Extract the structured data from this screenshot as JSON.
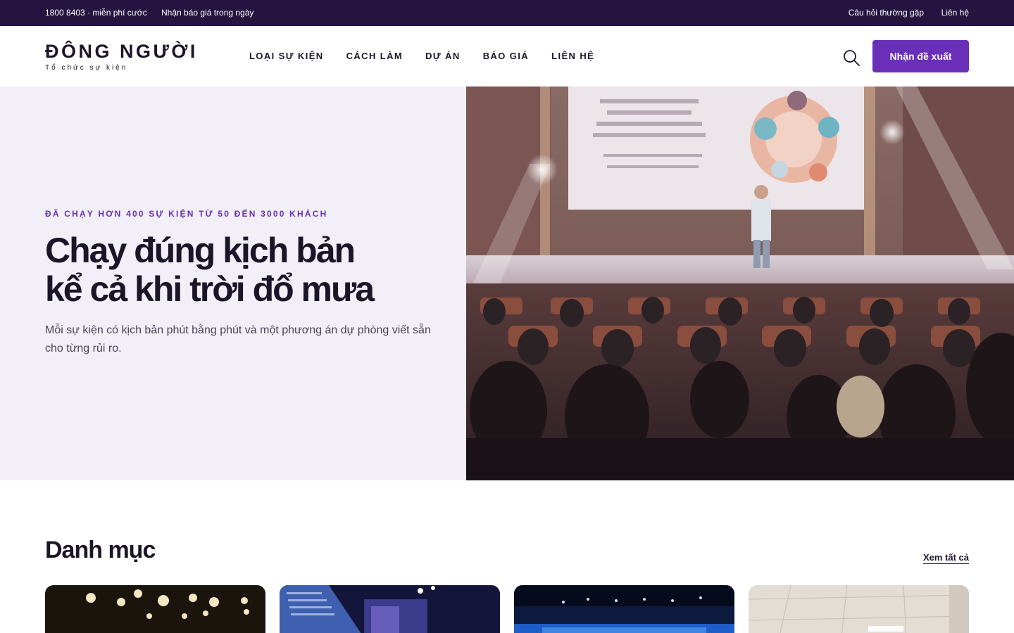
{
  "topbar": {
    "phone": "1800 8403 · miễn phí cước",
    "quote_note": "Nhận báo giá trong ngày",
    "faq": "Câu hỏi thường gặp",
    "contact": "Liên hệ"
  },
  "header": {
    "logo_title": "ĐÔNG NGƯỜI",
    "logo_subtitle": "Tổ chức sự kiện",
    "nav": [
      "LOẠI SỰ KIỆN",
      "CÁCH LÀM",
      "DỰ ÁN",
      "BÁO GIÁ",
      "LIÊN HỆ"
    ],
    "search_icon": "search-icon",
    "cta_label": "Nhận đề xuất"
  },
  "hero": {
    "eyebrow": "ĐÃ CHẠY HƠN 400 SỰ KIỆN TỪ 50 ĐẾN 3000 KHÁCH",
    "headline_line1": "Chạy đúng kịch bản",
    "headline_line2": "kể cả khi trời đổ mưa",
    "lede": "Mỗi sự kiện có kịch bản phút bằng phút và một phương án dự phòng viết sẵn cho từng rủi ro.",
    "image": "conference-audience-photo"
  },
  "categories": {
    "title": "Danh mục",
    "see_all": "Xem tất cả",
    "cards": [
      "concert-lights-photo",
      "presentation-screen-photo",
      "blue-stage-photo",
      "office-ceiling-photo"
    ]
  },
  "colors": {
    "topbar_bg": "#24143f",
    "accent": "#6a2fb8",
    "hero_bg": "#f2eff9",
    "text_dark": "#1c1528"
  }
}
